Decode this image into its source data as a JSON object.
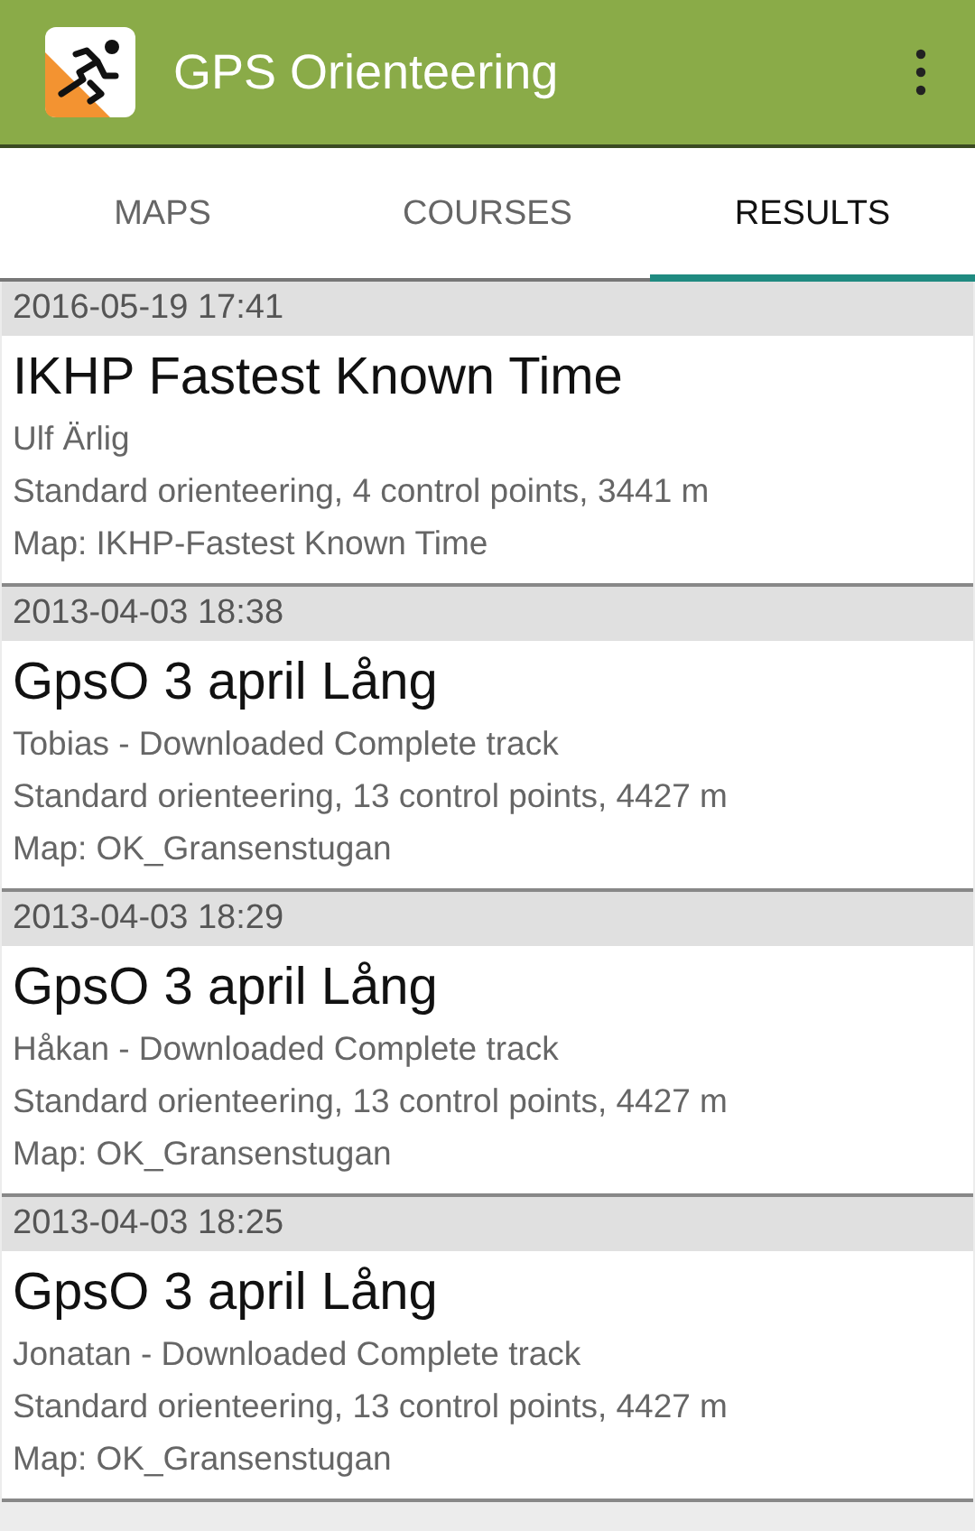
{
  "app_bar": {
    "title": "GPS Orienteering"
  },
  "tabs": [
    {
      "label": "MAPS",
      "selected": false
    },
    {
      "label": "COURSES",
      "selected": false
    },
    {
      "label": "RESULTS",
      "selected": true
    }
  ],
  "results": [
    {
      "date": "2016-05-19 17:41",
      "title": "IKHP Fastest Known Time",
      "runner": "Ulf Ärlig",
      "course": "Standard orienteering, 4 control points, 3441 m",
      "map": "Map: IKHP-Fastest Known Time"
    },
    {
      "date": "2013-04-03 18:38",
      "title": "GpsO 3 april Lång",
      "runner": "Tobias - Downloaded Complete track",
      "course": "Standard orienteering, 13 control points, 4427 m",
      "map": "Map: OK_Gransenstugan"
    },
    {
      "date": "2013-04-03 18:29",
      "title": "GpsO 3 april Lång",
      "runner": "Håkan - Downloaded Complete track",
      "course": "Standard orienteering, 13 control points, 4427 m",
      "map": "Map: OK_Gransenstugan"
    },
    {
      "date": "2013-04-03 18:25",
      "title": "GpsO 3 april Lång",
      "runner": "Jonatan - Downloaded Complete track",
      "course": "Standard orienteering, 13 control points, 4427 m",
      "map": "Map: OK_Gransenstugan"
    }
  ]
}
